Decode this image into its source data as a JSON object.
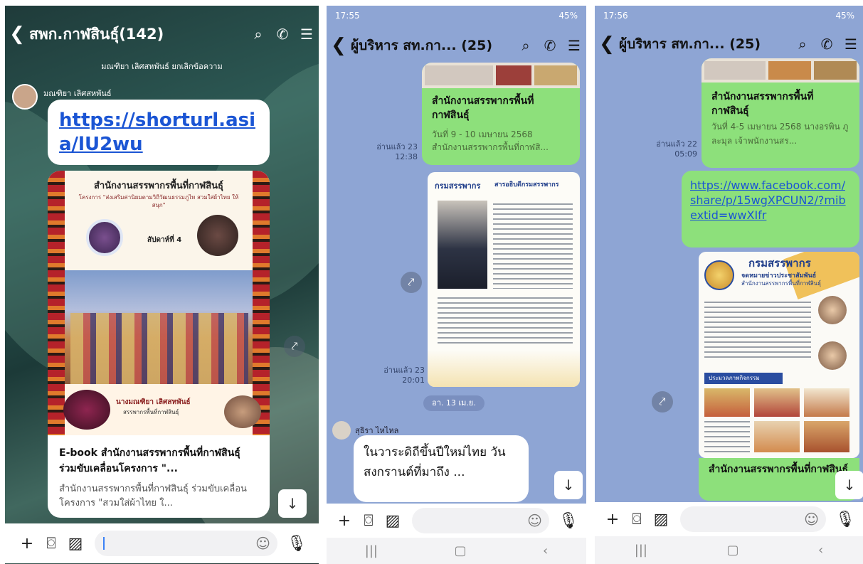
{
  "p1": {
    "title": "สพก.กาฬสินธุ์(142)",
    "unsend_notice": "มณฑิยา เลิศสหพันธ์ ยกเลิกข้อความ",
    "sender": "มณฑิยา เลิศสหพันธ์",
    "link": "https://shorturl.asia/lU2wu",
    "poster_title": "สำนักงานสรรพากรพื้นที่กาฬสินธุ์",
    "poster_subtitle": "โครงการ \"ส่งเสริมค่านิยมตามวิถีวัฒนธรรมภูไท สวมใส่ผ้าไทย ให้สนุก\"",
    "poster_week": "สัปดาห์ที่ 4",
    "poster_name": "นางมณฑิยา เลิศสหพันธ์",
    "poster_role": "สรรพากรพื้นที่กาฬสินธุ์",
    "card_title": "E-book สำนักงานสรรพากรพื้นที่กาฬสินธุ์ ร่วมขับเคลื่อนโครงการ \"...",
    "card_desc": "สำนักงานสรรพากรพื้นที่กาฬสินธุ์ ร่วมขับเคลื่อนโครงการ \"สวมใส่ผ้าไทย ใ..."
  },
  "p2": {
    "time": "17:55",
    "battery": "45%",
    "title": "ผู้บริหาร สท.กา... (25)",
    "msg1_title": "สำนักงานสรรพากรพื้นที่กาฬสินธุ์",
    "msg1_desc": "วันที่ 9 - 10 เมษายน 2568 สำนักงานสรรพากรพื้นที่กาฬสิ...",
    "read1": "อ่านแล้ว 23",
    "time1": "12:38",
    "poster_brand": "กรมสรรพากร",
    "poster_head": "สารอธิบดีกรมสรรพากร",
    "read2": "อ่านแล้ว 23",
    "time2": "20:01",
    "date_chip": "อา. 13 เม.ย.",
    "sender": "สุธิรา ไหไหล",
    "msg3": "ในวาระดิถีขึ้นปีใหม่ไทย วันสงกรานต์ที่มาถึง ..."
  },
  "p3": {
    "time": "17:56",
    "battery": "45%",
    "title": "ผู้บริหาร สท.กา... (25)",
    "msg1_title": "สำนักงานสรรพากรพื้นที่กาฬสินธุ์",
    "msg1_desc": "วันที่ 4-5 เมษายน 2568 นางอรพิน ภูละมุล เจ้าพนักงานสร...",
    "read1": "อ่านแล้ว 22",
    "time1": "05:09",
    "link": "https://www.facebook.com/share/p/15wgXPCUN2/?mibextid=wwXIfr",
    "poster_brand": "กรมสรรพากร",
    "poster_head": "จดหมายข่าวประชาสัมพันธ์",
    "poster_sub": "สำนักงานสรรพากรพื้นที่กาฬสินธุ์",
    "poster_section": "ประมวลภาพกิจกรรม",
    "msg2_title": "สำนักงานสรรพากรพื้นที่กาฬสินธุ์"
  }
}
